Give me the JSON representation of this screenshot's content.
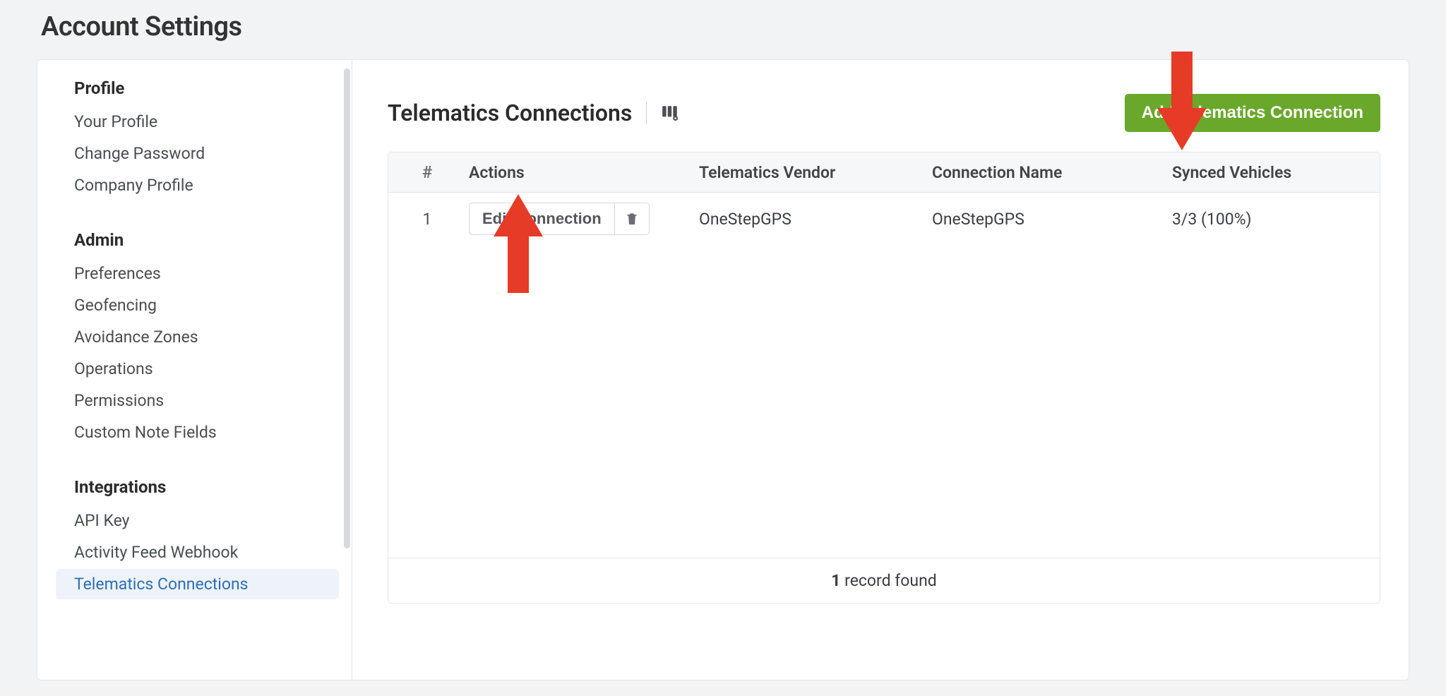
{
  "page_title": "Account Settings",
  "sidebar": {
    "sections": [
      {
        "title": "Profile",
        "items": [
          {
            "label": "Your Profile",
            "active": false
          },
          {
            "label": "Change Password",
            "active": false
          },
          {
            "label": "Company Profile",
            "active": false
          }
        ]
      },
      {
        "title": "Admin",
        "items": [
          {
            "label": "Preferences",
            "active": false
          },
          {
            "label": "Geofencing",
            "active": false
          },
          {
            "label": "Avoidance Zones",
            "active": false
          },
          {
            "label": "Operations",
            "active": false
          },
          {
            "label": "Permissions",
            "active": false
          },
          {
            "label": "Custom Note Fields",
            "active": false
          }
        ]
      },
      {
        "title": "Integrations",
        "items": [
          {
            "label": "API Key",
            "active": false
          },
          {
            "label": "Activity Feed Webhook",
            "active": false
          },
          {
            "label": "Telematics Connections",
            "active": true
          }
        ]
      }
    ]
  },
  "main": {
    "title": "Telematics Connections",
    "add_button": "Add Telematics Connection",
    "columns": {
      "num": "#",
      "actions": "Actions",
      "vendor": "Telematics Vendor",
      "name": "Connection Name",
      "synced": "Synced Vehicles"
    },
    "rows": [
      {
        "num": "1",
        "edit_label": "Edit Connection",
        "vendor": "OneStepGPS",
        "name": "OneStepGPS",
        "synced": "3/3 (100%)"
      }
    ],
    "footer": {
      "count": "1",
      "suffix": " record found"
    }
  },
  "annotations": {
    "arrow_up_note": "points at Edit Connection",
    "arrow_down_note": "points at Synced Vehicles header / Add button area"
  }
}
